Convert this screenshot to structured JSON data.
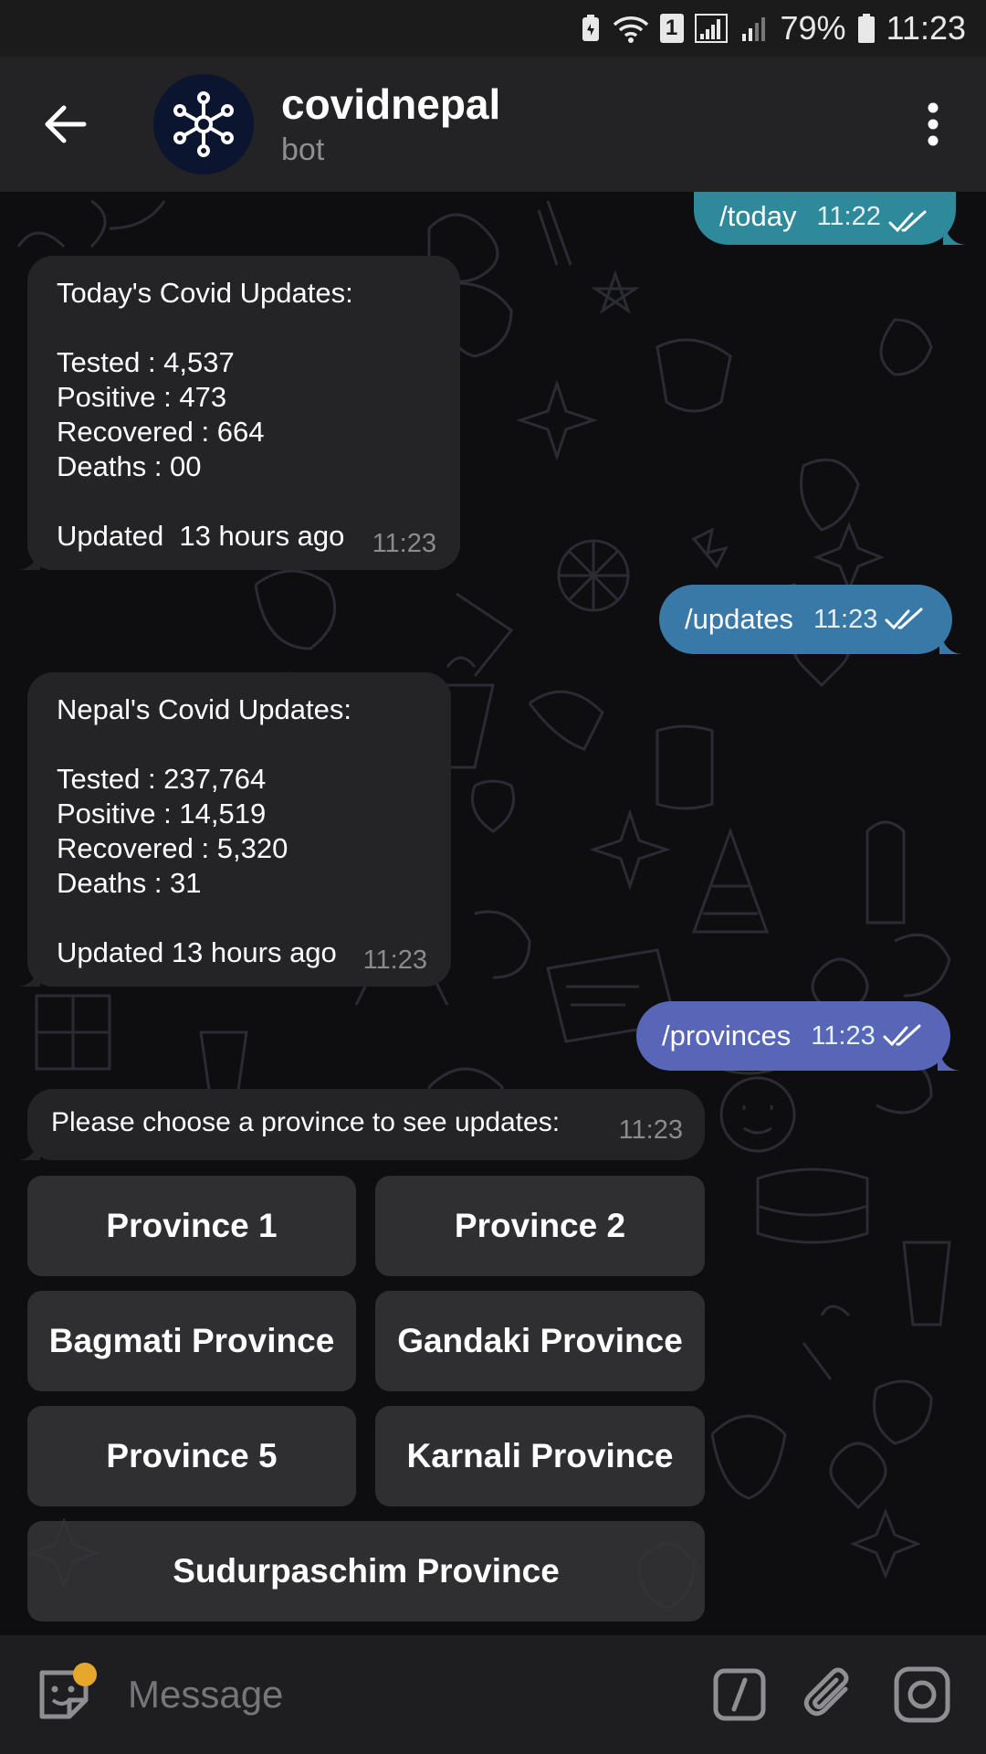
{
  "status_bar": {
    "sim_number": "1",
    "battery": "79%",
    "time": "11:23"
  },
  "header": {
    "title": "covidnepal",
    "subtitle": "bot"
  },
  "colors": {
    "bubble_today": "#2e8a9a",
    "bubble_updates": "#3979a8",
    "bubble_provinces": "#5866b8",
    "incoming_bubble": "#242426",
    "keyboard_button": "#343438",
    "emoji_dot": "#e6a82c"
  },
  "messages": {
    "out_today": {
      "text": "/today",
      "time": "11:22"
    },
    "in_today": {
      "lines": [
        "Today's Covid Updates:",
        "",
        "Tested : 4,537",
        "Positive : 473",
        "Recovered : 664",
        "Deaths : 00",
        ""
      ],
      "footer": "Updated  13 hours ago",
      "time": "11:23"
    },
    "out_updates": {
      "text": "/updates",
      "time": "11:23"
    },
    "in_nepal": {
      "lines": [
        "Nepal's Covid Updates:",
        "",
        "Tested : 237,764",
        "Positive : 14,519",
        "Recovered : 5,320",
        "Deaths : 31",
        ""
      ],
      "footer": "Updated 13 hours ago",
      "time": "11:23"
    },
    "out_provinces": {
      "text": "/provinces",
      "time": "11:23"
    },
    "in_choose": {
      "text": "Please choose a province to see updates:",
      "time": "11:23"
    }
  },
  "keyboard": {
    "province_1": "Province 1",
    "province_2": "Province 2",
    "bagmati": "Bagmati Province",
    "gandaki": "Gandaki Province",
    "province_5": "Province 5",
    "karnali": "Karnali Province",
    "sudurpaschim": "Sudurpaschim Province"
  },
  "input": {
    "placeholder": "Message",
    "value": ""
  }
}
